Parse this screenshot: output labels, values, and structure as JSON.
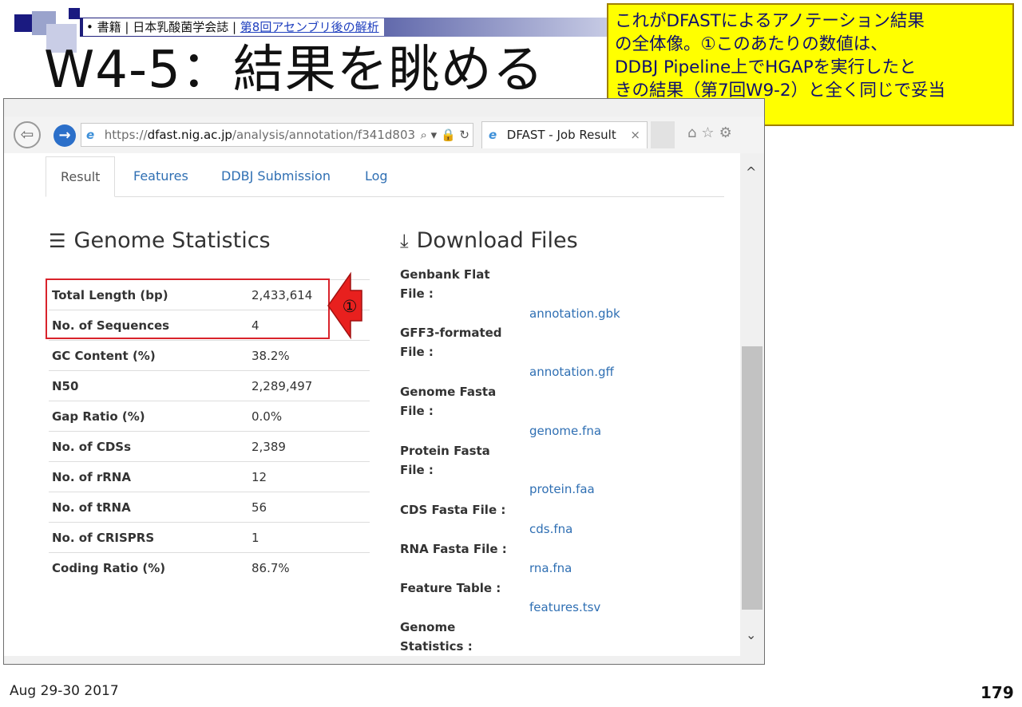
{
  "slide": {
    "breadcrumb_prefix": "• 書籍 | 日本乳酸菌学会誌 | ",
    "breadcrumb_link": "第8回アセンブリ後の解析",
    "title": "W4-5：結果を眺める",
    "callout_lines": [
      "これがDFASTによるアノテーション結果",
      "の全体像。①このあたりの数値は、",
      "DDBJ Pipeline上でHGAPを実行したと",
      "きの結果（第7回W9-2）と全く同じで妥当"
    ],
    "arrow_label": "①",
    "date": "Aug 29-30 2017",
    "page_number": "179"
  },
  "browser": {
    "back_glyph": "⇦",
    "forward_glyph": "→",
    "url_prefix": "https://",
    "url_host": "dfast.nig.ac.jp",
    "url_path": "/analysis/annotation/f341d803",
    "address_controls": "⌕ ▾ 🔒 ↻",
    "tab_title": "DFAST - Job Result",
    "tab_close": "×",
    "toolbar_icons": "⌂☆⚙",
    "scroll_up": "^",
    "scroll_down": "⌄"
  },
  "page": {
    "tabs": [
      "Result",
      "Features",
      "DDBJ Submission",
      "Log"
    ],
    "genome_stats_heading": "Genome Statistics",
    "download_heading": "Download Files",
    "stats": [
      {
        "label": "Total Length (bp)",
        "value": "2,433,614"
      },
      {
        "label": "No. of Sequences",
        "value": "4"
      },
      {
        "label": "GC Content (%)",
        "value": "38.2%"
      },
      {
        "label": "N50",
        "value": "2,289,497"
      },
      {
        "label": "Gap Ratio (%)",
        "value": "0.0%"
      },
      {
        "label": "No. of CDSs",
        "value": "2,389"
      },
      {
        "label": "No. of rRNA",
        "value": "12"
      },
      {
        "label": "No. of tRNA",
        "value": "56"
      },
      {
        "label": "No. of CRISPRS",
        "value": "1"
      },
      {
        "label": "Coding Ratio (%)",
        "value": "86.7%"
      }
    ],
    "downloads": [
      {
        "label_lines": [
          "Genbank Flat",
          "File :"
        ],
        "file": "annotation.gbk"
      },
      {
        "label_lines": [
          "GFF3-formated",
          "File :"
        ],
        "file": "annotation.gff"
      },
      {
        "label_lines": [
          "Genome Fasta",
          "File :"
        ],
        "file": "genome.fna"
      },
      {
        "label_lines": [
          "Protein Fasta",
          "File :"
        ],
        "file": "protein.faa"
      },
      {
        "label_lines": [
          "CDS Fasta File :"
        ],
        "file": "cds.fna"
      },
      {
        "label_lines": [
          "RNA Fasta File :"
        ],
        "file": "rna.fna"
      },
      {
        "label_lines": [
          "Feature Table :"
        ],
        "file": "features.tsv"
      },
      {
        "label_lines": [
          "Genome",
          "Statistics :"
        ],
        "file": ""
      }
    ]
  },
  "colors": {
    "link": "#2f6fb3",
    "highlight_border": "#d9232b",
    "arrow_fill": "#e8201e",
    "callout_bg": "#ffff00",
    "callout_text": "#0e0e6e"
  }
}
